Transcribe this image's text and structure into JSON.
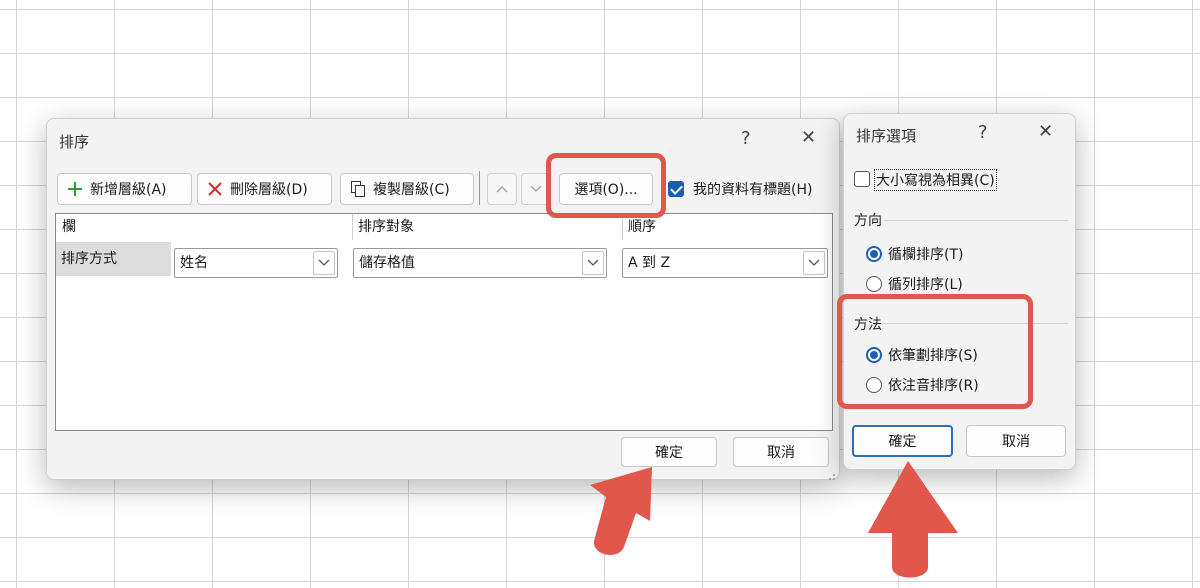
{
  "sort_dialog": {
    "title": "排序",
    "help": "?",
    "close": "✕",
    "toolbar": {
      "add_level": "新增層級(A)",
      "delete_level": "刪除層級(D)",
      "copy_level": "複製層級(C)",
      "options": "選項(O)...",
      "has_headers_label": "我的資料有標題(H)",
      "has_headers_checked": true
    },
    "columns": {
      "column": "欄",
      "sort_on": "排序對象",
      "order": "順序"
    },
    "row": {
      "label": "排序方式",
      "column_value": "姓名",
      "sort_on_value": "儲存格值",
      "order_value": "A 到 Z"
    },
    "ok": "確定",
    "cancel": "取消"
  },
  "options_dialog": {
    "title": "排序選項",
    "help": "?",
    "close": "✕",
    "case_sensitive_label": "大小寫視為相異(C)",
    "case_sensitive_checked": false,
    "orientation_title": "方向",
    "orientation_options": [
      "循欄排序(T)",
      "循列排序(L)"
    ],
    "orientation_selected": "循欄排序(T)",
    "method_title": "方法",
    "method_options": [
      "依筆劃排序(S)",
      "依注音排序(R)"
    ],
    "method_selected": "依筆劃排序(S)",
    "ok": "確定",
    "cancel": "取消"
  },
  "colors": {
    "accent": "#1a5fb4",
    "highlight": "#e2574c",
    "dialog_bg": "#f3f3f3"
  },
  "icons": [
    "plus-icon",
    "delete-x-icon",
    "copy-icon",
    "arrow-up-icon",
    "arrow-down-icon",
    "chevron-down-icon",
    "resize-grip-icon"
  ]
}
